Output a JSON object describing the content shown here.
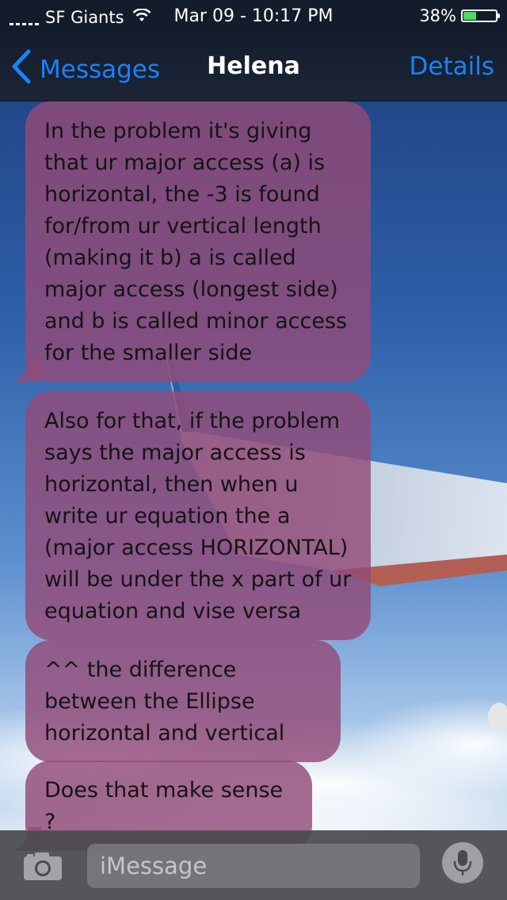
{
  "status_bar": {
    "carrier": "SF Giants",
    "time": "Mar 09 - 10:17 PM",
    "battery_percent": "38%",
    "battery_level": 0.38,
    "battery_color": "#4cd964"
  },
  "nav": {
    "back_label": "Messages",
    "title": "Helena",
    "details_label": "Details",
    "accent_color": "#1a82fb"
  },
  "messages": [
    {
      "direction": "incoming",
      "text": "In the problem it's giving that ur major access (a) is horizontal, the -3 is found for/from ur vertical length (making it b) a is called major access (longest side) and b is called minor access for the smaller side"
    },
    {
      "direction": "incoming",
      "text": "Also for that, if the problem says the major access is horizontal, then when u write ur equation the a (major access HORIZONTAL) will be under the x part of ur equation and vise versa"
    },
    {
      "direction": "incoming",
      "text": "^^ the difference between the Ellipse horizontal and vertical"
    },
    {
      "direction": "incoming",
      "text": "Does that make sense ?"
    }
  ],
  "bubble_color": "#934b78",
  "input_bar": {
    "placeholder": "iMessage",
    "value": "",
    "camera_icon": "camera-icon",
    "mic_icon": "microphone-icon"
  }
}
